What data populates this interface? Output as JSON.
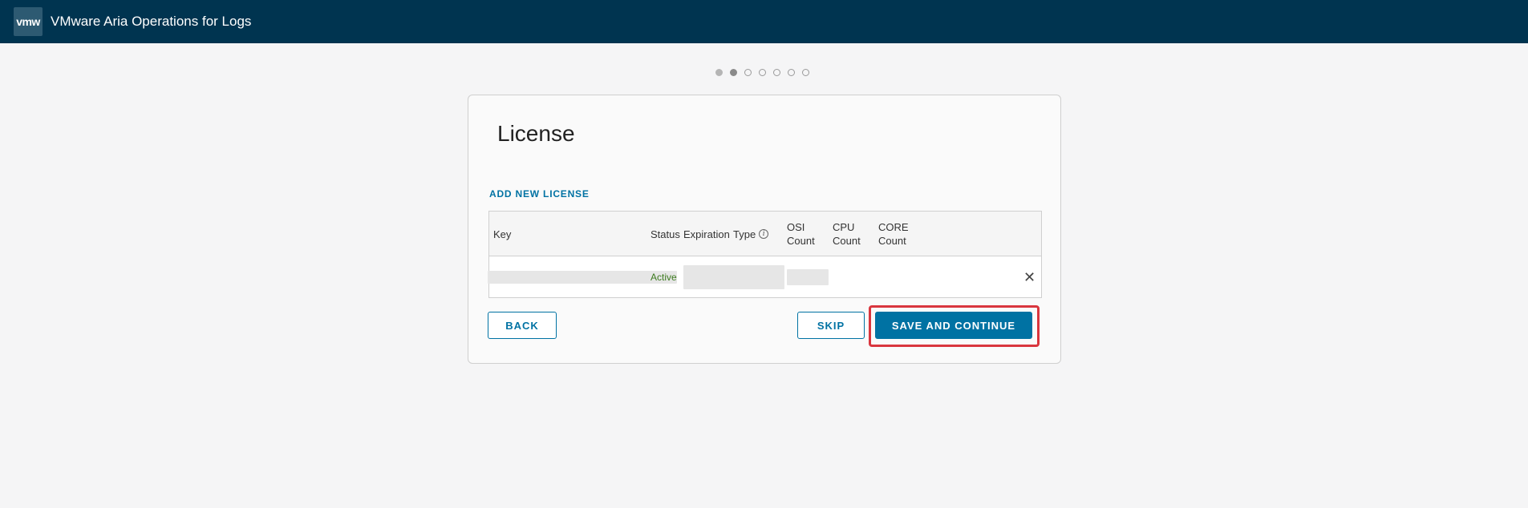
{
  "header": {
    "logo_text": "vmw",
    "app_title": "VMware Aria Operations for Logs"
  },
  "stepper": {
    "steps": 7,
    "current": 2
  },
  "card": {
    "title": "License",
    "add_link": "ADD NEW LICENSE",
    "table": {
      "columns": {
        "key": "Key",
        "status": "Status",
        "expiration": "Expiration",
        "type": "Type",
        "osi_1": "OSI",
        "osi_2": "Count",
        "cpu_1": "CPU",
        "cpu_2": "Count",
        "core_1": "CORE",
        "core_2": "Count"
      },
      "rows": [
        {
          "status": "Active"
        }
      ]
    },
    "buttons": {
      "back": "BACK",
      "skip": "SKIP",
      "save": "SAVE AND CONTINUE"
    }
  },
  "icons": {
    "info": "info-icon",
    "close": "close-icon"
  },
  "colors": {
    "header": "#003450",
    "accent": "#0072a3",
    "highlight": "#d9363e",
    "active": "#3c7a1e"
  }
}
